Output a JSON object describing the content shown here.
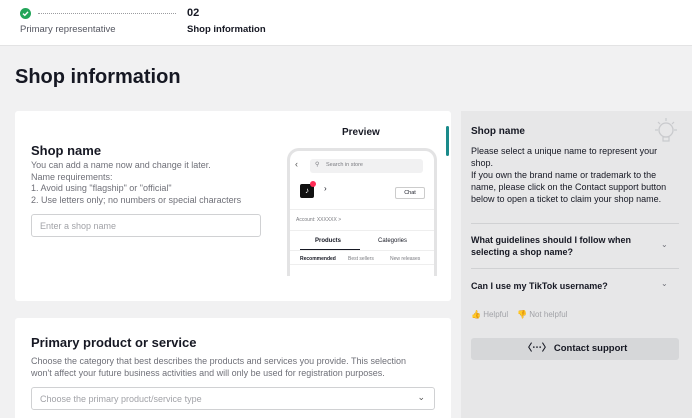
{
  "stepper": {
    "step2_number": "02",
    "step1_label": "Primary representative",
    "step2_label": "Shop information"
  },
  "page": {
    "title": "Shop information"
  },
  "shop_name": {
    "title": "Shop name",
    "help": [
      "You can add a name now and change it later.",
      "Name requirements:",
      "1. Avoid using \"flagship\" or \"official\"",
      "2. Use letters only; no numbers or special characters"
    ],
    "placeholder": "Enter a shop name"
  },
  "preview": {
    "label": "Preview",
    "search_placeholder": "Search in store",
    "chat_button": "Chat",
    "account": "Account: XXXXXX >",
    "tabs": [
      "Products",
      "Categories"
    ],
    "subtabs": [
      "Recommended",
      "Best sellers",
      "New releases"
    ]
  },
  "primary_product": {
    "title": "Primary product or service",
    "help": [
      "Choose the category that best describes the products and services you provide. This selection",
      "won't affect your future business activities and will only be used for registration purposes."
    ],
    "placeholder": "Choose the primary product/service type"
  },
  "side_panel": {
    "title": "Shop name",
    "body": [
      "Please select a unique name to represent your",
      "shop.",
      "If you own the brand name or trademark to the",
      "name, please click on the Contact support button",
      "below to open a ticket to claim your shop name."
    ],
    "faq": [
      [
        "What guidelines should I follow when",
        "selecting a shop name?"
      ],
      [
        "Can I use my TikTok username?"
      ]
    ],
    "helpful": "Helpful",
    "not_helpful": "Not helpful",
    "contact_support": "Contact support"
  },
  "colors": {
    "success": "#22a559",
    "accent": "#1a8a8a",
    "brand_pink": "#fe2c55"
  }
}
